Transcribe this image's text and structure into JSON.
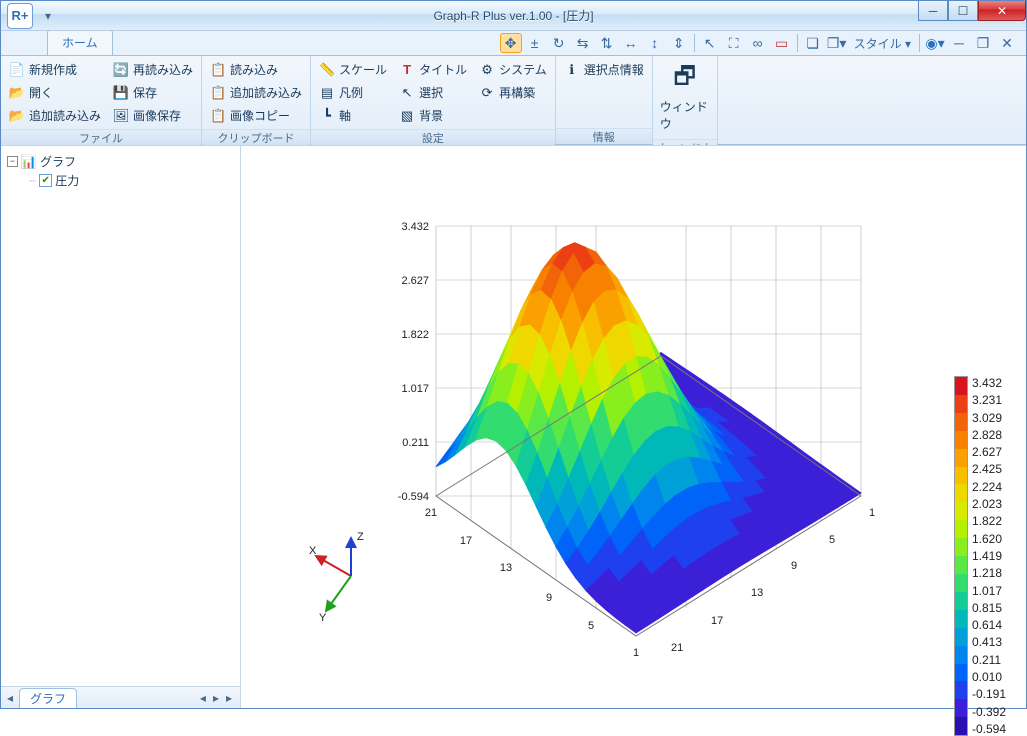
{
  "window": {
    "title": "Graph-R Plus ver.1.00 - [圧力]"
  },
  "ribbon": {
    "tab_home": "ホーム",
    "file": {
      "new": "新規作成",
      "open": "開く",
      "append": "追加読み込み",
      "reload": "再読み込み",
      "save": "保存",
      "save_image": "画像保存",
      "group": "ファイル"
    },
    "clipboard": {
      "load": "読み込み",
      "append": "追加読み込み",
      "copy_image": "画像コピー",
      "group": "クリップボード"
    },
    "settings": {
      "scale": "スケール",
      "legend": "凡例",
      "axis": "軸",
      "title": "タイトル",
      "select": "選択",
      "background": "背景",
      "system": "システム",
      "rebuild": "再構築",
      "group": "設定"
    },
    "info": {
      "sel_point": "選択点情報",
      "group": "情報"
    },
    "window_grp": {
      "window": "ウィンドウ",
      "group": "ウィンドウ"
    }
  },
  "quickbar": {
    "style": "スタイル"
  },
  "tree": {
    "root": "グラフ",
    "item1": "圧力",
    "tab": "グラフ"
  },
  "chart_data": {
    "type": "surface3d",
    "x_axis": {
      "ticks": [
        1.0,
        5.0,
        9.0,
        13.0,
        17.0,
        21.0
      ],
      "label": "X"
    },
    "y_axis": {
      "ticks": [
        1.0,
        5.0,
        9.0,
        13.0,
        17.0,
        21.0
      ],
      "label": "Y"
    },
    "z_axis": {
      "ticks": [
        -0.594,
        0.211,
        1.017,
        1.822,
        2.627,
        3.432
      ],
      "label": "Z",
      "range": [
        -0.594,
        3.432
      ]
    },
    "colorbar": {
      "values": [
        3.432,
        3.231,
        3.029,
        2.828,
        2.627,
        2.425,
        2.224,
        2.023,
        1.822,
        1.62,
        1.419,
        1.218,
        1.017,
        0.815,
        0.614,
        0.413,
        0.211,
        0.01,
        -0.191,
        -0.392,
        -0.594
      ],
      "colors": [
        "#d8141e",
        "#ec4014",
        "#f2640a",
        "#f88200",
        "#faa000",
        "#f8be00",
        "#eed800",
        "#d8ea00",
        "#b4f000",
        "#88ee1e",
        "#5ae846",
        "#32dc6e",
        "#14cc96",
        "#00b8b8",
        "#00a0d8",
        "#0084ee",
        "#0064f8",
        "#1e40ee",
        "#3c20d8",
        "#2a10b0"
      ]
    },
    "axis_labels": {
      "x": "X",
      "y": "Y",
      "z": "Z"
    }
  }
}
